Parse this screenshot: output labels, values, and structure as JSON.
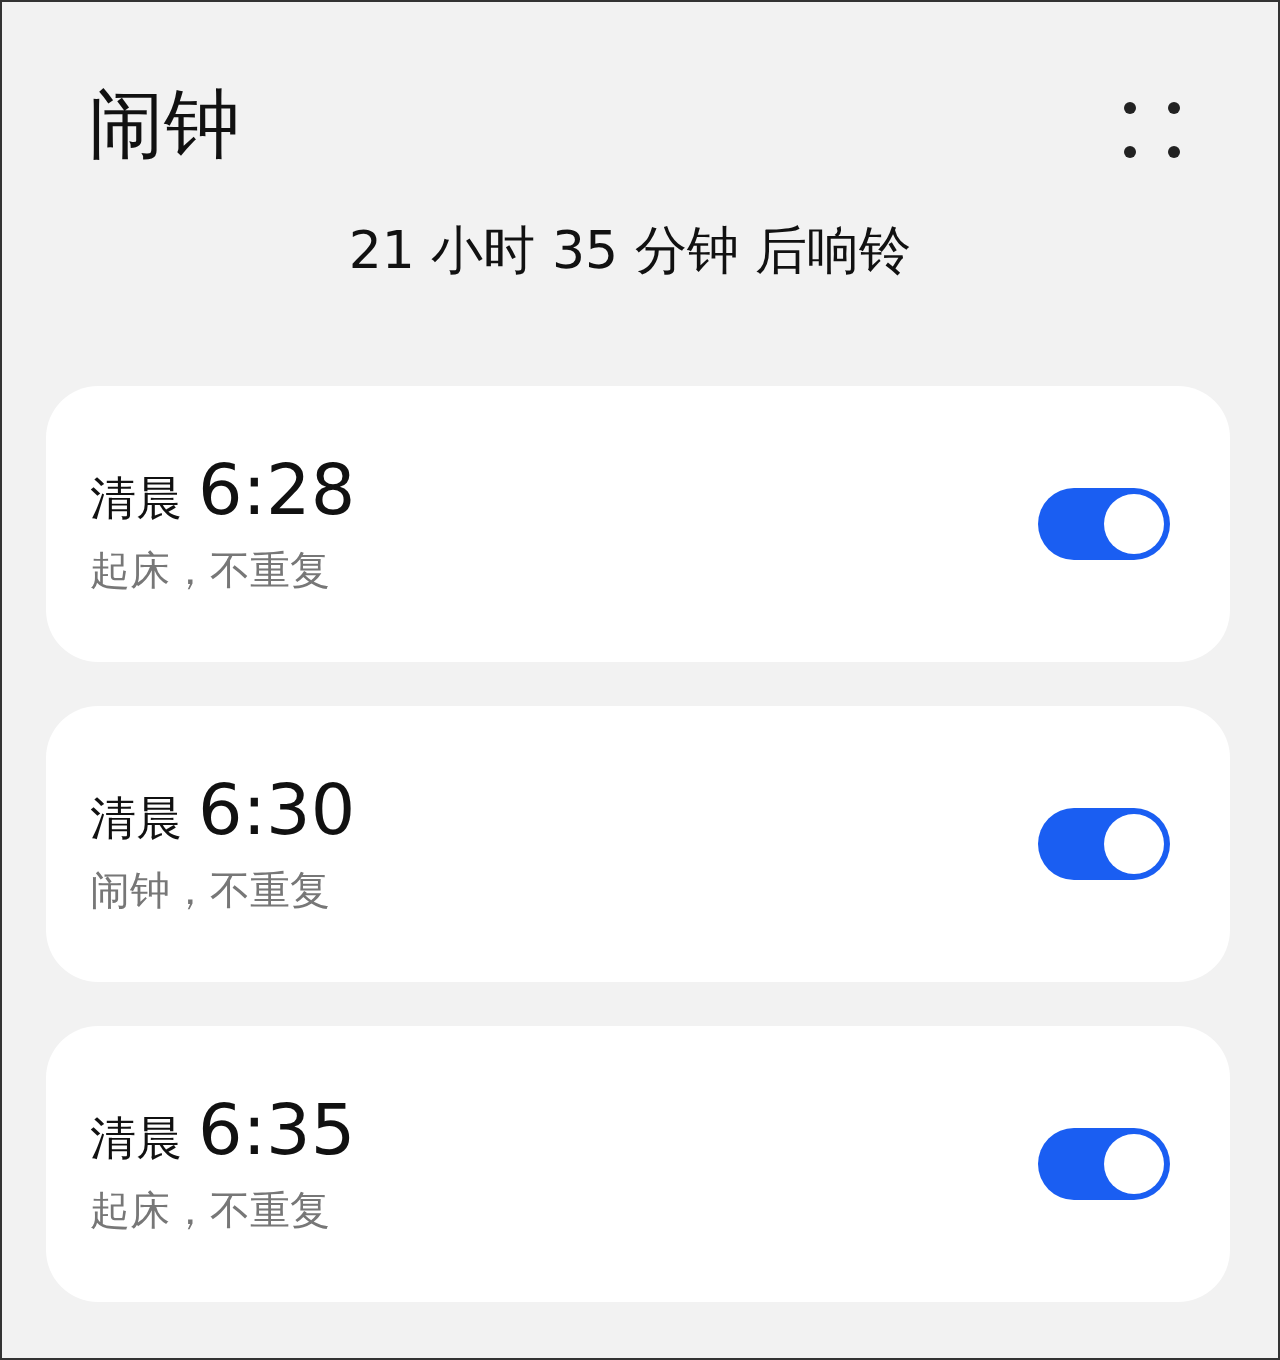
{
  "header": {
    "title": "闹钟",
    "subtitle": "21 小时 35 分钟 后响铃"
  },
  "alarms": [
    {
      "period": "清晨",
      "time": "6:28",
      "note": "起床，不重复",
      "on": true
    },
    {
      "period": "清晨",
      "time": "6:30",
      "note": "闹钟，不重复",
      "on": true
    },
    {
      "period": "清晨",
      "time": "6:35",
      "note": "起床，不重复",
      "on": true
    }
  ]
}
